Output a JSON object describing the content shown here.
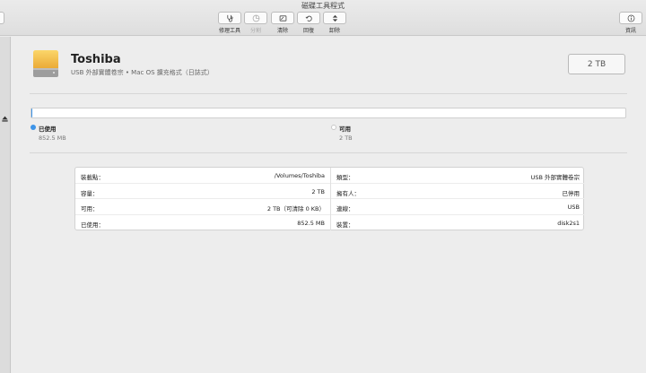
{
  "window": {
    "title": "磁碟工具程式"
  },
  "toolbar": {
    "buttons": [
      {
        "label": "修理工具",
        "icon": "stethoscope-icon",
        "enabled": true
      },
      {
        "label": "分割",
        "icon": "pie-partition-icon",
        "enabled": false
      },
      {
        "label": "清除",
        "icon": "erase-icon",
        "enabled": true
      },
      {
        "label": "回復",
        "icon": "restore-icon",
        "enabled": true
      },
      {
        "label": "卸除",
        "icon": "unmount-icon",
        "enabled": true
      }
    ],
    "info_label": "資訊",
    "info_icon": "info-icon"
  },
  "disk": {
    "name": "Toshiba",
    "subtitle": "USB 外部實體卷宗 • Mac OS 擴充格式（日誌式）",
    "size": "2 TB",
    "icon": "external-drive-icon"
  },
  "usage": {
    "used_fraction": 0.0004,
    "used_color": "#3d94e8",
    "free_color": "#ffffff",
    "used": {
      "label": "已使用",
      "value": "852.5 MB"
    },
    "free": {
      "label": "可用",
      "value": "2 TB"
    }
  },
  "info": {
    "left": [
      {
        "key": "裝載點：",
        "value": "/Volumes/Toshiba"
      },
      {
        "key": "容量：",
        "value": "2 TB"
      },
      {
        "key": "可用：",
        "value": "2 TB（可清除 0 KB）"
      },
      {
        "key": "已使用：",
        "value": "852.5 MB"
      }
    ],
    "right": [
      {
        "key": "類型：",
        "value": "USB 外部實體卷宗"
      },
      {
        "key": "擁有人：",
        "value": "已停用"
      },
      {
        "key": "連線：",
        "value": "USB"
      },
      {
        "key": "裝置：",
        "value": "disk2s1"
      }
    ]
  }
}
